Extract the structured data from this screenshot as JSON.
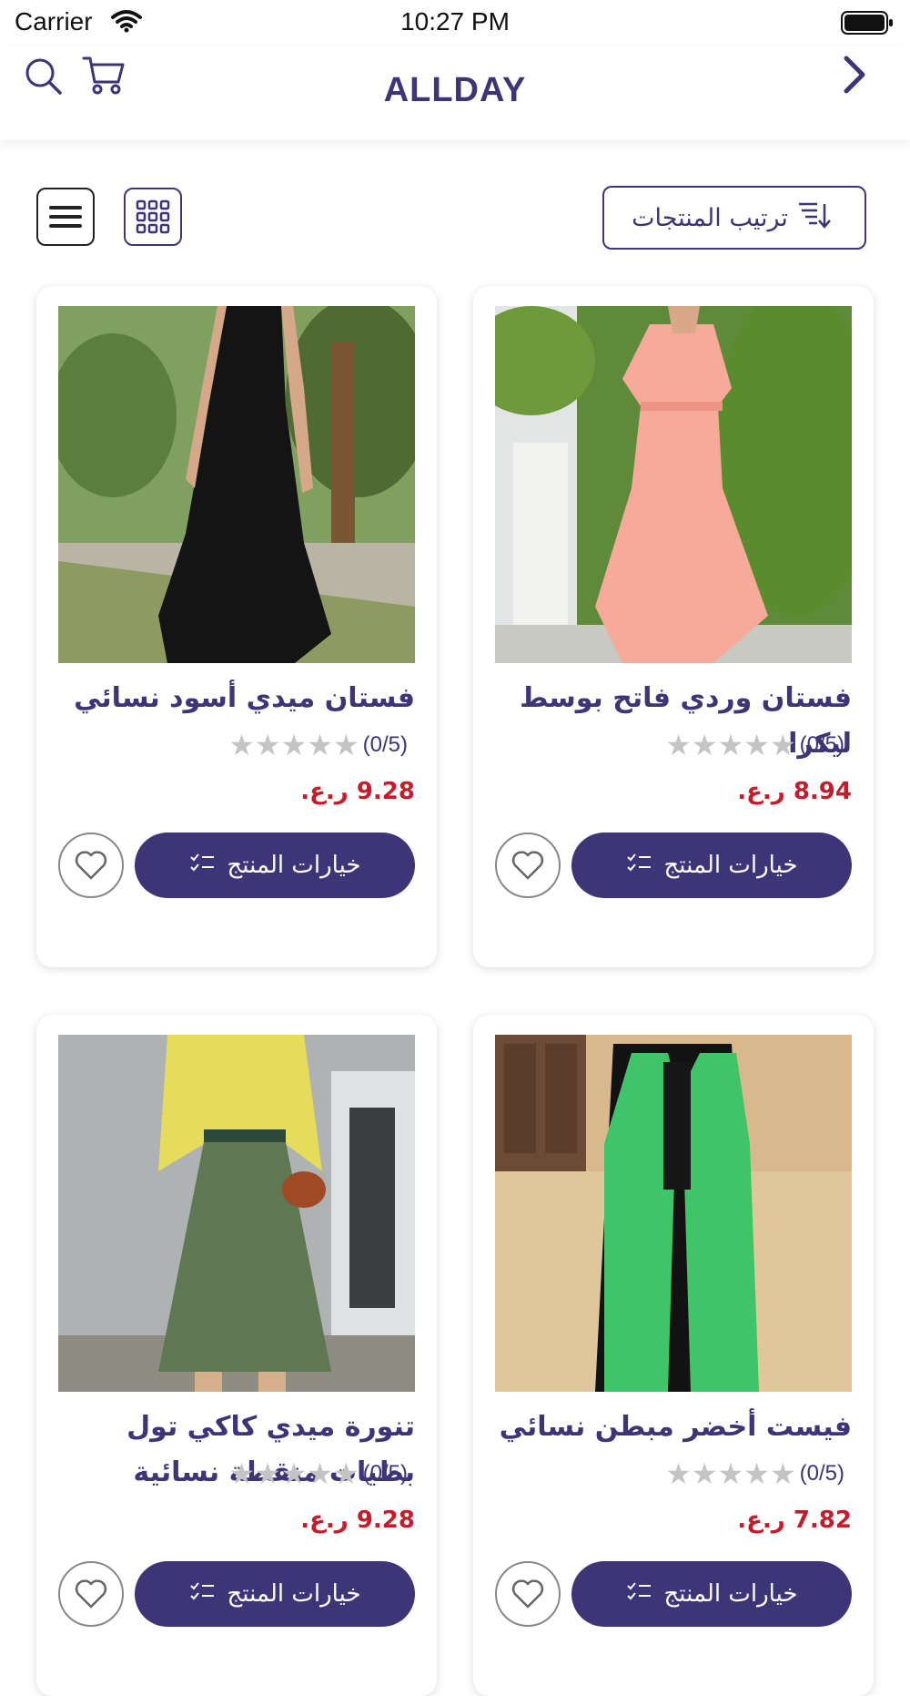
{
  "status_bar": {
    "carrier": "Carrier",
    "time": "10:27 PM"
  },
  "header": {
    "brand": "ALLDAY"
  },
  "toolbar": {
    "sort_label": "ترتيب المنتجات"
  },
  "products": [
    {
      "title": "فستان ميدي أسود نسائي",
      "rating_text": "(0/5)",
      "stars": 0,
      "price": "9.28 ر.ع.",
      "options_label": "خيارات المنتج",
      "image": "black-midi-dress-photo"
    },
    {
      "title": "فستان وردي فاتح بوسط ليكرا",
      "rating_text": "(0/5)",
      "stars": 0,
      "price": "8.94 ر.ع.",
      "options_label": "خيارات المنتج",
      "image": "light-pink-dress-photo"
    },
    {
      "title": "تنورة ميدي كاكي تول بطيات منقطة نسائية",
      "rating_text": "(0/5)",
      "stars": 0,
      "price": "9.28 ر.ع.",
      "options_label": "خيارات المنتج",
      "image": "khaki-tulle-skirt-photo"
    },
    {
      "title": "فيست أخضر مبطن نسائي",
      "rating_text": "(0/5)",
      "stars": 0,
      "price": "7.82 ر.ع.",
      "options_label": "خيارات المنتج",
      "image": "green-padded-vest-photo"
    }
  ],
  "colors": {
    "primary": "#3d3577",
    "price": "#c51c2c",
    "star_empty": "#c4c4c4"
  }
}
